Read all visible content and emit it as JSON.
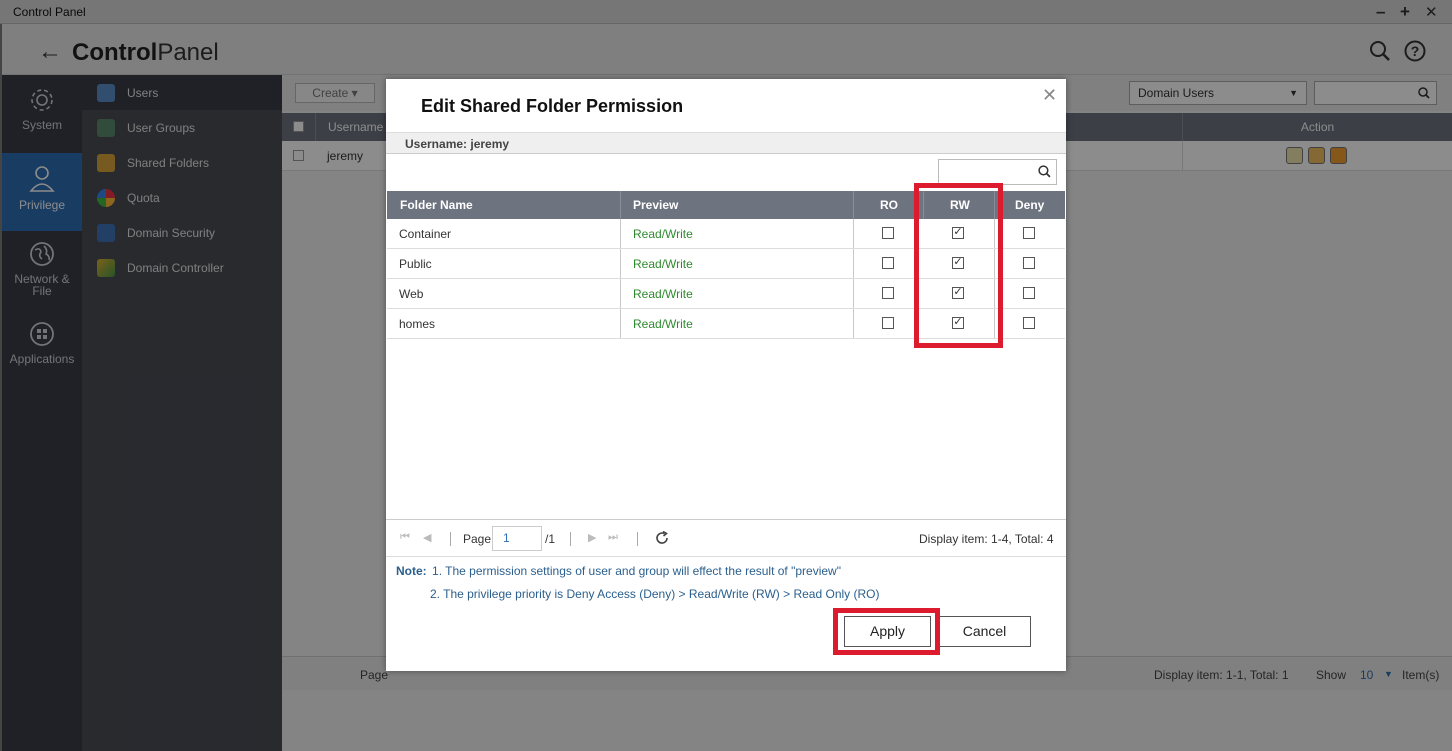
{
  "window": {
    "title": "Control Panel",
    "min_glyph": "–",
    "max_glyph": "+",
    "close_glyph": "✕"
  },
  "header": {
    "back_glyph": "←",
    "title_bold": "Control",
    "title_light": "Panel"
  },
  "nav": [
    {
      "label": "System",
      "icon": "gear-icon"
    },
    {
      "label": "Privilege",
      "icon": "person-icon",
      "active": true
    },
    {
      "label": "Network &\nFile",
      "icon": "globe-icon"
    },
    {
      "label": "Applications",
      "icon": "grid-icon"
    }
  ],
  "subnav": [
    {
      "label": "Users",
      "icon": "user-icon",
      "active": true
    },
    {
      "label": "User Groups",
      "icon": "user-group-icon"
    },
    {
      "label": "Shared Folders",
      "icon": "shared-folder-icon"
    },
    {
      "label": "Quota",
      "icon": "quota-icon"
    },
    {
      "label": "Domain Security",
      "icon": "domain-security-icon"
    },
    {
      "label": "Domain Controller",
      "icon": "domain-controller-icon"
    }
  ],
  "main": {
    "create_label": "Create",
    "domain_select": "Domain Users",
    "columns": {
      "username": "Username",
      "action": "Action"
    },
    "rows": [
      {
        "username": "jeremy"
      }
    ],
    "pager": {
      "page_label": "Page",
      "display": "Display item: 1-1, Total: 1",
      "show_label": "Show",
      "show_value": "10",
      "items_label": "Item(s)"
    }
  },
  "modal": {
    "title": "Edit Shared Folder Permission",
    "close_glyph": "✕",
    "username_label": "Username: jeremy",
    "columns": {
      "folder": "Folder Name",
      "preview": "Preview",
      "ro": "RO",
      "rw": "RW",
      "deny": "Deny"
    },
    "rows": [
      {
        "folder": "Container",
        "preview": "Read/Write",
        "ro": false,
        "rw": true,
        "deny": false
      },
      {
        "folder": "Public",
        "preview": "Read/Write",
        "ro": false,
        "rw": true,
        "deny": false
      },
      {
        "folder": "Web",
        "preview": "Read/Write",
        "ro": false,
        "rw": true,
        "deny": false
      },
      {
        "folder": "homes",
        "preview": "Read/Write",
        "ro": false,
        "rw": true,
        "deny": false
      }
    ],
    "pager": {
      "page_label": "Page",
      "page_value": "1",
      "page_total": "/1",
      "display": "Display item: 1-4, Total: 4"
    },
    "note_label": "Note:",
    "note_1": "1. The permission settings of user and group will effect the result of \"preview\"",
    "note_2": "2. The privilege priority is Deny Access (Deny) > Read/Write (RW) > Read Only (RO)",
    "apply_label": "Apply",
    "cancel_label": "Cancel"
  },
  "colors": {
    "nav_active": "#2f6eb5",
    "highlight": "#dc1c2e",
    "preview_text": "#2f8a2f",
    "table_header": "#6e7380"
  }
}
